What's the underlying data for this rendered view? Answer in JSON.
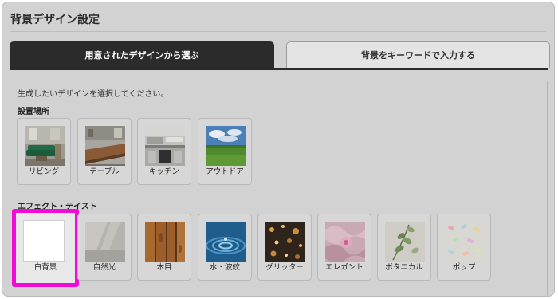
{
  "page_title": "背景デザイン設定",
  "tabs": [
    {
      "label": "用意されたデザインから選ぶ",
      "active": true
    },
    {
      "label": "背景をキーワードで入力する",
      "active": false
    }
  ],
  "instruction": "生成したいデザインを選択してください。",
  "sections": {
    "location": {
      "heading": "設置場所",
      "options": [
        "リビング",
        "テーブル",
        "キッチン",
        "アウトドア"
      ]
    },
    "effect": {
      "heading": "エフェクト・テイスト",
      "options": [
        "白背景",
        "自然光",
        "木目",
        "水・波紋",
        "グリッター",
        "エレガント",
        "ボタニカル",
        "ポップ"
      ],
      "selected": "白背景"
    }
  },
  "colors": {
    "active_tab": "#2b2b2b",
    "selection_highlight": "#f20ad6",
    "overlay": "#d2d2d2"
  }
}
